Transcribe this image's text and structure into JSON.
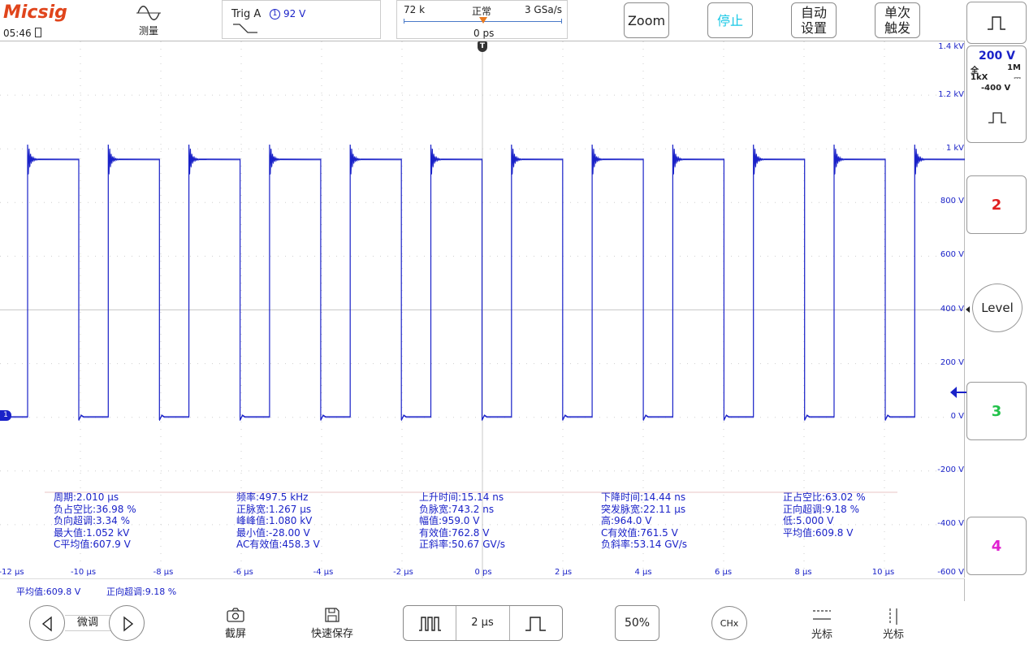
{
  "header": {
    "logo": "Micsig",
    "time": "05:46",
    "measure_label": "测量",
    "trig": {
      "label": "Trig A",
      "channel": "1",
      "level": "92 V"
    },
    "timebase": {
      "memory": "72 k",
      "mode": "正常",
      "rate": "3 GSa/s",
      "offset": "0 ps"
    },
    "buttons": {
      "zoom": "Zoom",
      "stop": "停止",
      "autoset_1": "自动",
      "autoset_2": "设置",
      "single_1": "单次",
      "single_2": "触发"
    }
  },
  "channel_panel": {
    "scale": "200 V",
    "bw": "全",
    "impedance": "1M",
    "probe": "1kX",
    "coupling": "⎓",
    "offset": "-400 V"
  },
  "side_buttons": {
    "ch2": "2",
    "level": "Level",
    "ch3": "3",
    "ch4": "4"
  },
  "voltage_labels": [
    "1.4 kV",
    "1.2 kV",
    "1 kV",
    "800 V",
    "600 V",
    "400 V",
    "200 V",
    "0 V",
    "-200 V",
    "-400 V",
    "-600 V"
  ],
  "time_labels": [
    "-12 µs",
    "-10 µs",
    "-8 µs",
    "-6 µs",
    "-4 µs",
    "-2 µs",
    "0 ps",
    "2 µs",
    "4 µs",
    "6 µs",
    "8 µs",
    "10 µs"
  ],
  "channel_marker": "1",
  "trigger_marker": "T",
  "measurements": [
    [
      "周期:2.010 µs",
      "负占空比:36.98 %",
      "负向超调:3.34 %",
      "最大值:1.052 kV",
      "C平均值:607.9 V"
    ],
    [
      "频率:497.5 kHz",
      "正脉宽:1.267 µs",
      "峰峰值:1.080 kV",
      "最小值:-28.00 V",
      "AC有效值:458.3 V"
    ],
    [
      "上升时间:15.14 ns",
      "负脉宽:743.2 ns",
      "幅值:959.0 V",
      "有效值:762.8 V",
      "正斜率:50.67 GV/s"
    ],
    [
      "下降时间:14.44 ns",
      "突发脉宽:22.11 µs",
      "高:964.0 V",
      "C有效值:761.5 V",
      "负斜率:53.14 GV/s"
    ],
    [
      "正占空比:63.02 %",
      "正向超调:9.18 %",
      "低:5.000 V",
      "平均值:609.8 V"
    ]
  ],
  "status_bar": {
    "item1": "平均值:609.8 V",
    "item2": "正向超调:9.18 %"
  },
  "bottom": {
    "fine": "微调",
    "screenshot": "截屏",
    "quick_save": "快速保存",
    "timebase": "2 µs",
    "fifty": "50%",
    "chx": "CHx",
    "cursor1": "光标",
    "cursor2": "光标"
  },
  "colors": {
    "trace": "#1a22c8",
    "logo": "#e0451c",
    "stop": "#19c8e6",
    "ch2": "#e02020",
    "ch3": "#22c24a",
    "ch4": "#e020d0",
    "trigger_marker": "#e87a20"
  },
  "icons": {
    "measure": "sine-wave-icon",
    "edge": "falling-edge-icon",
    "prev": "triangle-left-icon",
    "next": "triangle-right-icon",
    "camera": "camera-icon",
    "save": "floppy-icon"
  }
}
